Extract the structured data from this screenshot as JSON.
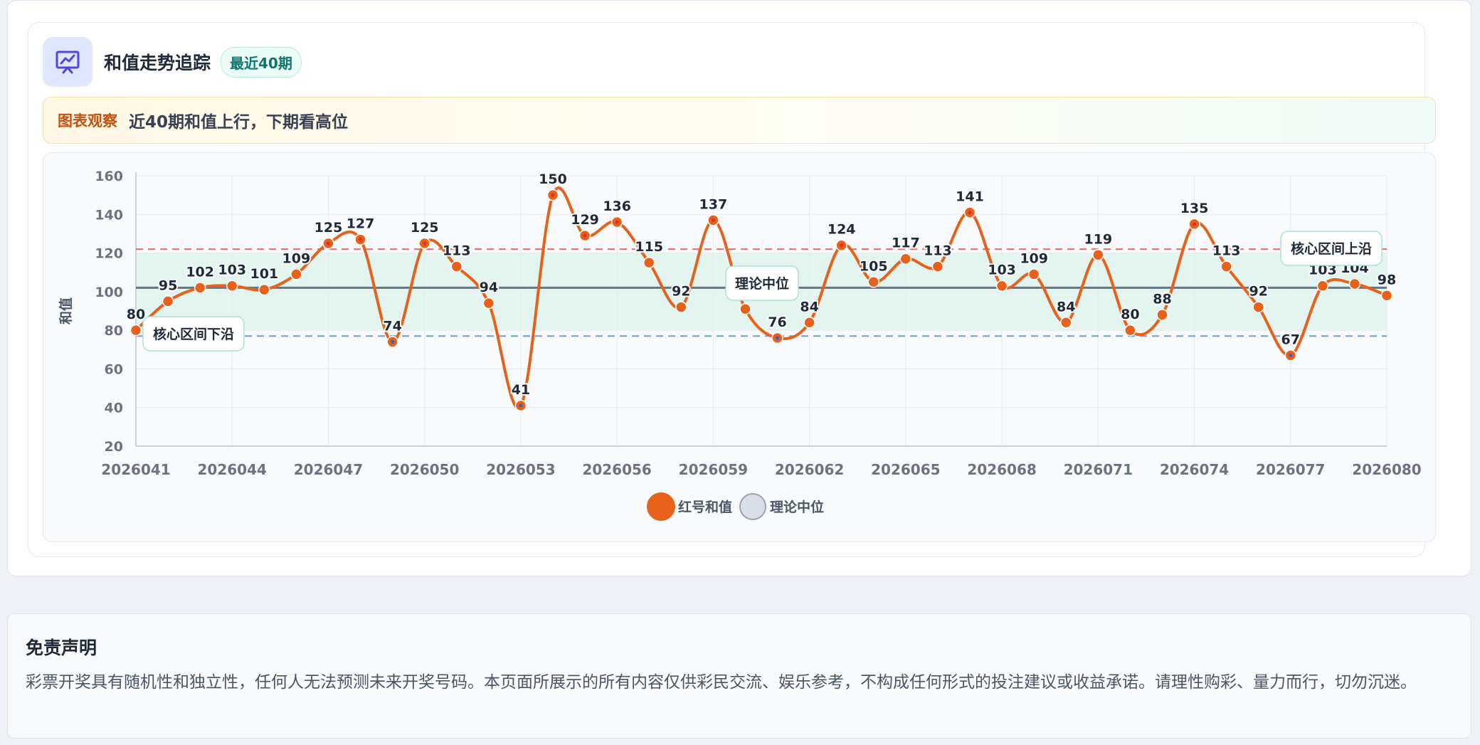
{
  "header": {
    "title": "和值走势追踪",
    "badge": "最近40期",
    "icon": "trend-chart-icon"
  },
  "observation": {
    "label": "图表观察",
    "text": "近40期和值上行，下期看高位"
  },
  "chart_data": {
    "type": "line",
    "ylabel": "和值",
    "xlabel": "",
    "ylim": [
      20,
      160
    ],
    "yticks": [
      20,
      40,
      60,
      80,
      100,
      120,
      140,
      160
    ],
    "xticks": [
      "2026041",
      "2026044",
      "2026047",
      "2026050",
      "2026053",
      "2026056",
      "2026059",
      "2026062",
      "2026065",
      "2026068",
      "2026071",
      "2026074",
      "2026077",
      "2026080"
    ],
    "grid": true,
    "legend_position": "bottom",
    "series": [
      {
        "name": "红号和值",
        "color": "#e8611a",
        "x": [
          "2026041",
          "2026042",
          "2026043",
          "2026044",
          "2026045",
          "2026046",
          "2026047",
          "2026048",
          "2026049",
          "2026050",
          "2026051",
          "2026052",
          "2026053",
          "2026054",
          "2026055",
          "2026056",
          "2026057",
          "2026058",
          "2026059",
          "2026060",
          "2026061",
          "2026062",
          "2026063",
          "2026064",
          "2026065",
          "2026066",
          "2026067",
          "2026068",
          "2026069",
          "2026070",
          "2026071",
          "2026072",
          "2026073",
          "2026074",
          "2026075",
          "2026076",
          "2026077",
          "2026078",
          "2026079",
          "2026080"
        ],
        "values": [
          80,
          95,
          102,
          103,
          101,
          109,
          125,
          127,
          74,
          125,
          113,
          94,
          41,
          150,
          129,
          136,
          115,
          92,
          137,
          91,
          76,
          84,
          124,
          105,
          117,
          113,
          141,
          103,
          109,
          84,
          119,
          80,
          88,
          135,
          113,
          92,
          67,
          103,
          104,
          98
        ]
      }
    ],
    "reference_lines": [
      {
        "name": "理论中位",
        "value": 102,
        "color": "#64748b"
      },
      {
        "name": "核心区间上沿",
        "value": 122,
        "color": "#ef6b6b"
      },
      {
        "name": "核心区间下沿",
        "value": 77,
        "color": "#6b9be8"
      }
    ],
    "band": {
      "from": 80,
      "to": 120,
      "color": "#e4f4ef"
    },
    "legend": [
      {
        "label": "红号和值",
        "color": "#e8611a"
      },
      {
        "label": "理论中位",
        "color": "#d9dee7"
      }
    ]
  },
  "disclaimer": {
    "title": "免责声明",
    "text": "彩票开奖具有随机性和独立性，任何人无法预测未来开奖号码。本页面所展示的所有内容仅供彩民交流、娱乐参考，不构成任何形式的投注建议或收益承诺。请理性购彩、量力而行，切勿沉迷。"
  }
}
